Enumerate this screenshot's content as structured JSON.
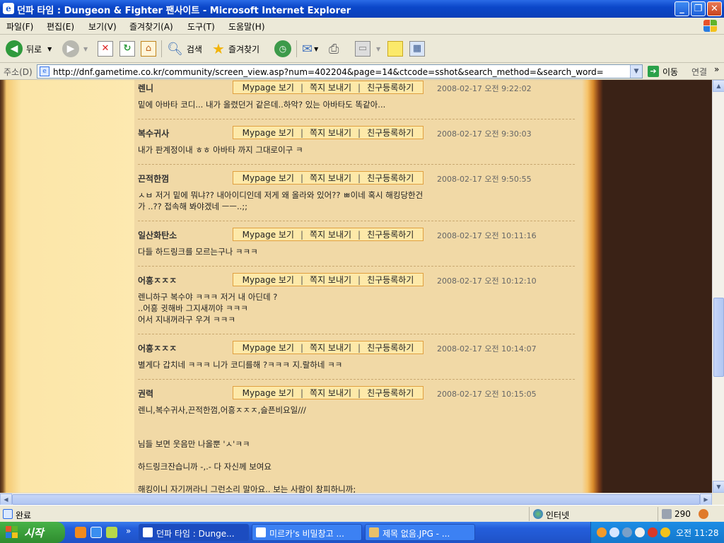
{
  "window": {
    "title": "던파 타임 : Dungeon & Fighter 팬사이트 - Microsoft Internet Explorer",
    "minimize": "_",
    "maximize": "❐",
    "close": "✕"
  },
  "menu": [
    "파일(F)",
    "편집(E)",
    "보기(V)",
    "즐겨찾기(A)",
    "도구(T)",
    "도움말(H)"
  ],
  "toolbar": {
    "back_label": "뒤로",
    "search_label": "검색",
    "favorites_label": "즐겨찾기"
  },
  "address": {
    "label": "주소(D)",
    "url": "http://dnf.gametime.co.kr/community/screen_view.asp?num=402204&page=14&ctcode=sshot&search_method=&search_word=",
    "go_label": "이동",
    "links_label": "연결"
  },
  "comment_buttons": {
    "mypage": "Mypage 보기",
    "message": "쪽지 보내기",
    "friend": "친구등록하기",
    "sep": "|"
  },
  "comments": [
    {
      "author": "렌니",
      "date": "2008-02-17 오전 9:22:02",
      "lines": [
        "밑에 아바타 코디... 내가 올렸던거 같은데..하악? 있는 아바타도 똑같아..."
      ]
    },
    {
      "author": "복수귀사",
      "date": "2008-02-17 오전 9:30:03",
      "lines": [
        "내가 판계정이내 ㅎㅎ 아바타 까지 그대로이구 ㅋ"
      ]
    },
    {
      "author": "끈적한껌",
      "date": "2008-02-17 오전 9:50:55",
      "lines": [
        "ㅅㅂ 저거 밑에 뭐냐?? 내아이디인데 저게 왜 올라와 있어?? ㅃ이네 혹시 해킹당한건",
        "가 ..?? 접속해 봐야겠네 ㅡㅡ..;;"
      ]
    },
    {
      "author": "일산화탄소",
      "date": "2008-02-17 오전 10:11:16",
      "lines": [
        "다들 하드링크를 모르는구나 ㅋㅋㅋ"
      ]
    },
    {
      "author": "어흥ㅈㅈㅈ",
      "date": "2008-02-17 오전 10:12:10",
      "lines": [
        "렌니하구 복수야 ㅋㅋㅋ 저거 내 아딘데 ?",
        "..어흥 귓해바 그지새끼야 ㅋㅋㅋ",
        "어서 지내꺼라구 우겨 ㅋㅋㅋ"
      ]
    },
    {
      "author": "어흥ㅈㅈㅈ",
      "date": "2008-02-17 오전 10:14:07",
      "lines": [
        "별게다 갑치네 ㅋㅋㅋ 니가 코디를해 ?ㅋㅋㅋ 지.랄하네 ㅋㅋ"
      ]
    },
    {
      "author": "권력",
      "date": "2008-02-17 오전 10:15:05",
      "lines": [
        "렌니,복수귀사,끈적한껌,어흥ㅈㅈㅈ,슬픈비요일///",
        "",
        "",
        "님들 보면 웃음만 나올뿐 'ㅅ'ㅋㅋ",
        "",
        "하드링크잔습니까 -,.- 다 자신께 보여요",
        "",
        "해킹이니 자기꺼라니 그런소리 말아요.. 보는 사람이 창피하니까;"
      ]
    }
  ],
  "status": {
    "text": "완료",
    "zone": "인터넷",
    "count": "290"
  },
  "taskbar": {
    "start_label": "시작",
    "more": "»",
    "tasks": [
      "던파 타임 : Dunge...",
      "미르카's 비밀창고 ...",
      "제목 없음.JPG - ..."
    ],
    "clock": "오전 11:28"
  }
}
